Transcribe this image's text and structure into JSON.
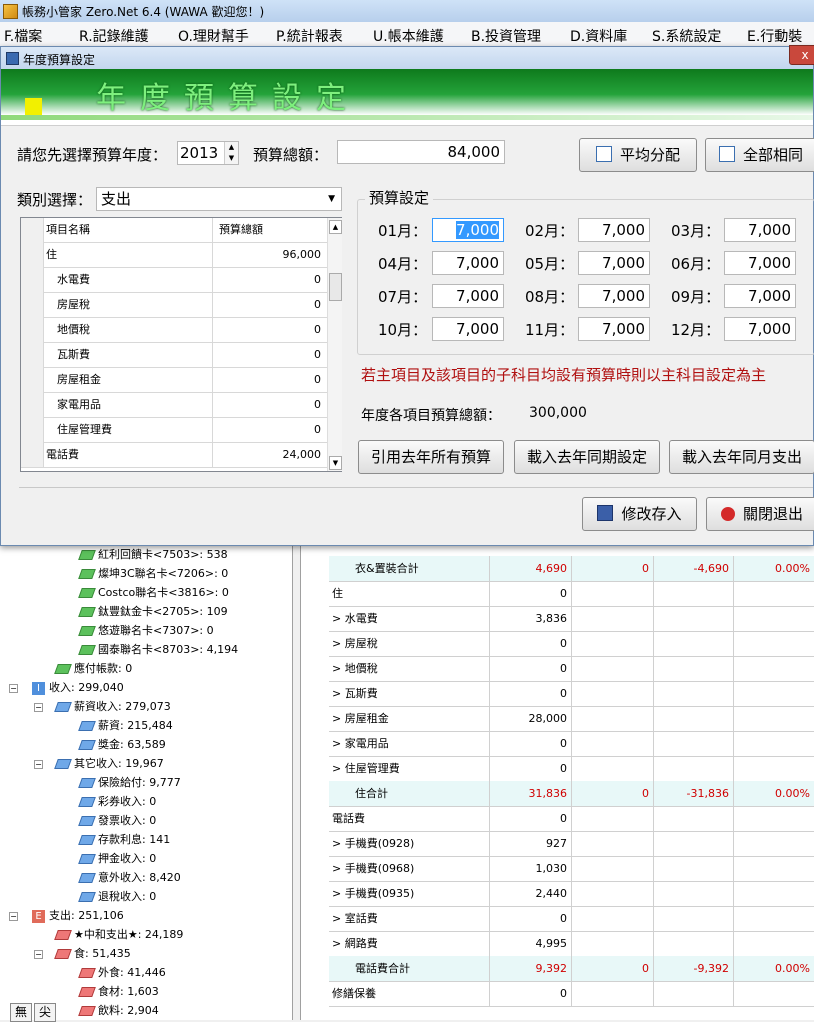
{
  "app": {
    "title": "帳務小管家 Zero.Net 6.4 (WAWA 歡迎您！)"
  },
  "menu": [
    "F.檔案",
    "R.記錄維護",
    "O.理財幫手",
    "P.統計報表",
    "U.帳本維護",
    "B.投資管理",
    "D.資料庫",
    "S.系統設定",
    "E.行動裝"
  ],
  "tree": {
    "items": [
      "紅利回饋卡<7503>: 538",
      "燦坤3C聯名卡<7206>: 0",
      "Costco聯名卡<3816>: 0",
      "鈦豐鈦金卡<2705>: 109",
      "悠遊聯名卡<7307>: 0",
      "國泰聯名卡<8703>: 4,194",
      "應付帳款: 0",
      "收入: 299,040",
      "薪資收入: 279,073",
      "薪資: 215,484",
      "獎金: 63,589",
      "其它收入: 19,967",
      "保險給付: 9,777",
      "彩券收入: 0",
      "發票收入: 0",
      "存款利息: 141",
      "押金收入: 0",
      "意外收入: 8,420",
      "退稅收入: 0",
      "支出: 251,106",
      "★中和支出★: 24,189",
      "食: 51,435",
      "外食: 41,446",
      "食材: 1,603",
      "飲料: 2,904"
    ],
    "badge_income": "I",
    "badge_expense": "E",
    "tabs": [
      "無",
      "尖"
    ]
  },
  "grid": {
    "rows": [
      {
        "name": "衣&置裝合計",
        "v1": "4,690",
        "v2": "0",
        "v3": "-4,690",
        "v4": "0.00%",
        "sum": true
      },
      {
        "name": "住",
        "v1": "0",
        "v2": "",
        "v3": "",
        "v4": "",
        "sum": false
      },
      {
        "name": "> 水電費",
        "v1": "3,836",
        "v2": "",
        "v3": "",
        "v4": "",
        "sum": false
      },
      {
        "name": "> 房屋稅",
        "v1": "0",
        "v2": "",
        "v3": "",
        "v4": "",
        "sum": false
      },
      {
        "name": "> 地價稅",
        "v1": "0",
        "v2": "",
        "v3": "",
        "v4": "",
        "sum": false
      },
      {
        "name": "> 瓦斯費",
        "v1": "0",
        "v2": "",
        "v3": "",
        "v4": "",
        "sum": false
      },
      {
        "name": "> 房屋租金",
        "v1": "28,000",
        "v2": "",
        "v3": "",
        "v4": "",
        "sum": false
      },
      {
        "name": "> 家電用品",
        "v1": "0",
        "v2": "",
        "v3": "",
        "v4": "",
        "sum": false
      },
      {
        "name": "> 住屋管理費",
        "v1": "0",
        "v2": "",
        "v3": "",
        "v4": "",
        "sum": false
      },
      {
        "name": "住合計",
        "v1": "31,836",
        "v2": "0",
        "v3": "-31,836",
        "v4": "0.00%",
        "sum": true
      },
      {
        "name": "電話費",
        "v1": "0",
        "v2": "",
        "v3": "",
        "v4": "",
        "sum": false
      },
      {
        "name": "> 手機費(0928)",
        "v1": "927",
        "v2": "",
        "v3": "",
        "v4": "",
        "sum": false
      },
      {
        "name": "> 手機費(0968)",
        "v1": "1,030",
        "v2": "",
        "v3": "",
        "v4": "",
        "sum": false
      },
      {
        "name": "> 手機費(0935)",
        "v1": "2,440",
        "v2": "",
        "v3": "",
        "v4": "",
        "sum": false
      },
      {
        "name": "> 室話費",
        "v1": "0",
        "v2": "",
        "v3": "",
        "v4": "",
        "sum": false
      },
      {
        "name": "> 網路費",
        "v1": "4,995",
        "v2": "",
        "v3": "",
        "v4": "",
        "sum": false
      },
      {
        "name": "電話費合計",
        "v1": "9,392",
        "v2": "0",
        "v3": "-9,392",
        "v4": "0.00%",
        "sum": true
      },
      {
        "name": "修繕保養",
        "v1": "0",
        "v2": "",
        "v3": "",
        "v4": "",
        "sum": false
      }
    ]
  },
  "dialog": {
    "title": "年度預算設定",
    "close": "x",
    "banner": "年度預算設定",
    "year_label": "請您先選擇預算年度：",
    "year_value": "2013",
    "total_label": "預算總額：",
    "total_value": "84,000",
    "btn_average": "平均分配",
    "btn_all_same": "全部相同",
    "category_label": "類別選擇：",
    "category_value": "支出",
    "list_headers": {
      "name": "項目名稱",
      "amount": "預算總額"
    },
    "list_rows": [
      {
        "name": "住",
        "amount": "96,000",
        "sub": false
      },
      {
        "name": "水電費",
        "amount": "0",
        "sub": true
      },
      {
        "name": "房屋稅",
        "amount": "0",
        "sub": true
      },
      {
        "name": "地價稅",
        "amount": "0",
        "sub": true
      },
      {
        "name": "瓦斯費",
        "amount": "0",
        "sub": true
      },
      {
        "name": "房屋租金",
        "amount": "0",
        "sub": true
      },
      {
        "name": "家電用品",
        "amount": "0",
        "sub": true
      },
      {
        "name": "住屋管理費",
        "amount": "0",
        "sub": true
      },
      {
        "name": "電話費",
        "amount": "24,000",
        "sub": false
      }
    ],
    "budget_group": "預算設定",
    "months": [
      {
        "label": "01月：",
        "value": "7,000"
      },
      {
        "label": "02月：",
        "value": "7,000"
      },
      {
        "label": "03月：",
        "value": "7,000"
      },
      {
        "label": "04月：",
        "value": "7,000"
      },
      {
        "label": "05月：",
        "value": "7,000"
      },
      {
        "label": "06月：",
        "value": "7,000"
      },
      {
        "label": "07月：",
        "value": "7,000"
      },
      {
        "label": "08月：",
        "value": "7,000"
      },
      {
        "label": "09月：",
        "value": "7,000"
      },
      {
        "label": "10月：",
        "value": "7,000"
      },
      {
        "label": "11月：",
        "value": "7,000"
      },
      {
        "label": "12月：",
        "value": "7,000"
      }
    ],
    "note": "若主項目及該項目的子科目均設有預算時則以主科目設定為主",
    "year_total_label": "年度各項目預算總額：",
    "year_total_value": "300,000",
    "btn_cite_last": "引用去年所有預算",
    "btn_load_last_setting": "載入去年同期設定",
    "btn_load_last_expense": "載入去年同月支出",
    "btn_save": "修改存入",
    "btn_exit": "關閉退出"
  },
  "colors": {
    "accent": "#24a33a",
    "note": "#b01010",
    "negative": "#d00000"
  }
}
